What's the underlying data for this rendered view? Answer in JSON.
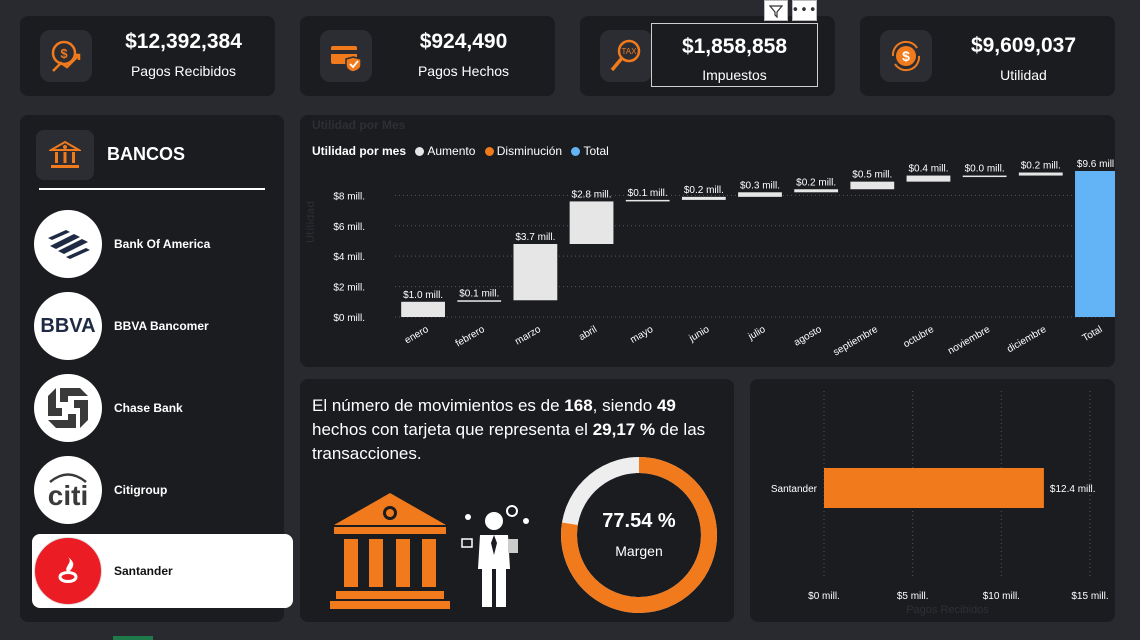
{
  "kpis": [
    {
      "value": "$12,392,384",
      "label": "Pagos Recibidos",
      "icon": "money-growth-icon"
    },
    {
      "value": "$924,490",
      "label": "Pagos Hechos",
      "icon": "card-shield-icon"
    },
    {
      "value": "$1,858,858",
      "label": "Impuestos",
      "icon": "tax-search-icon"
    },
    {
      "value": "$9,609,037",
      "label": "Utilidad",
      "icon": "dollar-coin-icon"
    }
  ],
  "toolbar": {
    "filter_icon": "filter-icon",
    "more_icon": "more-options-icon"
  },
  "banks": {
    "title": "BANCOS",
    "items": [
      {
        "name": "Bank Of America",
        "logo_text": ""
      },
      {
        "name": "BBVA Bancomer",
        "logo_text": "BBVA"
      },
      {
        "name": "Chase Bank",
        "logo_text": ""
      },
      {
        "name": "Citigroup",
        "logo_text": "citi"
      },
      {
        "name": "Santander",
        "logo_text": "",
        "selected": true
      }
    ]
  },
  "waterfall": {
    "faded_title": "Utilidad por Mes",
    "legend_title": "Utilidad por mes",
    "legend": [
      {
        "label": "Aumento",
        "color": "#e6e6e6"
      },
      {
        "label": "Disminución",
        "color": "#f07a1c"
      },
      {
        "label": "Total",
        "color": "#62b4f7"
      }
    ],
    "faded_ylabel": "Utilidad"
  },
  "movimientos": {
    "p1": "El número de movimientos es de ",
    "n1": "168",
    "p2": ", siendo ",
    "n2": "49",
    "p3": " hechos con tarjeta que representa el ",
    "n3": "29,17 %",
    "p4": " de las transacciones."
  },
  "donut": {
    "value_text": "77.54 %",
    "label": "Margen",
    "percent": 77.54,
    "color": "#f07a1c",
    "track": "#eeeeee"
  },
  "bar_chart": {
    "faded_xlabel": "Pagos Recibidos"
  },
  "chart_data": [
    {
      "type": "waterfall",
      "title": "Utilidad por mes",
      "categories": [
        "enero",
        "febrero",
        "marzo",
        "abril",
        "mayo",
        "junio",
        "julio",
        "agosto",
        "septiembre",
        "octubre",
        "noviembre",
        "diciembre",
        "Total"
      ],
      "values": [
        1.0,
        0.1,
        3.7,
        2.8,
        0.1,
        0.2,
        0.3,
        0.2,
        0.5,
        0.4,
        0.0,
        0.2,
        9.6
      ],
      "labels": [
        "$1.0 mill.",
        "$0.1 mill.",
        "$3.7 mill.",
        "$2.8 mill.",
        "$0.1 mill.",
        "$0.2 mill.",
        "$0.3 mill.",
        "$0.2 mill.",
        "$0.5 mill.",
        "$0.4 mill.",
        "$0.0 mill.",
        "$0.2 mill.",
        "$9.6 mill."
      ],
      "kinds": [
        "increase",
        "increase",
        "increase",
        "increase",
        "increase",
        "increase",
        "increase",
        "increase",
        "increase",
        "increase",
        "increase",
        "increase",
        "total"
      ],
      "yticks": [
        "$0 mill.",
        "$2 mill.",
        "$4 mill.",
        "$6 mill.",
        "$8 mill."
      ],
      "ylim": [
        0,
        9.6
      ],
      "grid": true
    },
    {
      "type": "bar",
      "orientation": "horizontal",
      "categories": [
        "Santander"
      ],
      "values": [
        12.4
      ],
      "labels": [
        "$12.4 mill."
      ],
      "xticks": [
        "$0 mill.",
        "$5 mill.",
        "$10 mill.",
        "$15 mill."
      ],
      "xlim": [
        0,
        15
      ],
      "xlabel": "Pagos Recibidos",
      "color": "#f07a1c",
      "grid": true
    }
  ]
}
